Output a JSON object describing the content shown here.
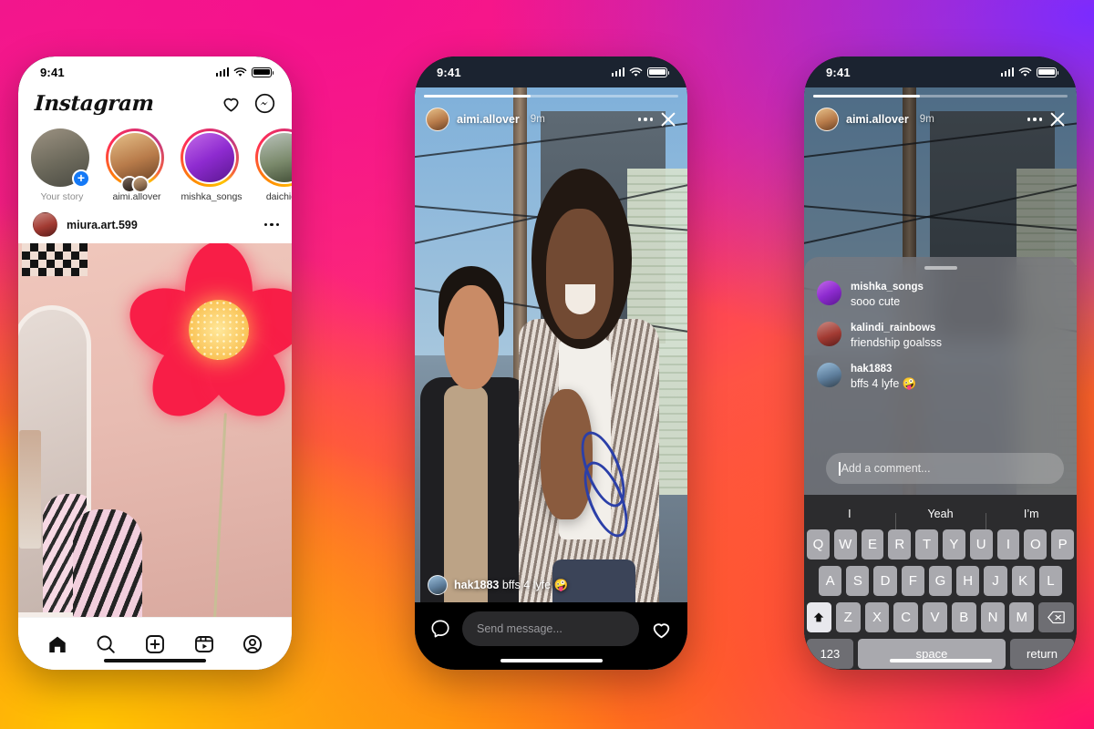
{
  "background": {
    "gradient_colors": [
      "#F01A8C",
      "#7B2BFF",
      "#FF2D72",
      "#FF8A00",
      "#FFC400"
    ]
  },
  "phone1": {
    "status": {
      "time": "9:41"
    },
    "header": {
      "logo": "Instagram",
      "like_icon": "heart-icon",
      "messenger_icon": "messenger-icon"
    },
    "stories": [
      {
        "name": "Your story",
        "has_ring": false,
        "has_plus": true,
        "avatar": "av-rock"
      },
      {
        "name": "aimi.allover",
        "has_ring": true,
        "has_plus": false,
        "avatar": "av-warm",
        "dual_badge": true
      },
      {
        "name": "mishka_songs",
        "has_ring": true,
        "has_plus": false,
        "avatar": "av-purple"
      },
      {
        "name": "daichiguy",
        "has_ring": true,
        "has_plus": false,
        "avatar": "av-grass"
      }
    ],
    "post": {
      "username": "miura.art.599",
      "menu_icon": "more-options-icon",
      "media_alt": "neon flower wall lamp in bedroom"
    },
    "tabbar": [
      {
        "icon": "home-icon",
        "label": "Home",
        "active": true
      },
      {
        "icon": "search-icon",
        "label": "Search",
        "active": false
      },
      {
        "icon": "create-icon",
        "label": "Create",
        "active": false
      },
      {
        "icon": "reels-icon",
        "label": "Reels",
        "active": false
      },
      {
        "icon": "profile-icon",
        "label": "Profile",
        "active": false
      }
    ]
  },
  "phone2": {
    "status": {
      "time": "9:41"
    },
    "story": {
      "username": "aimi.allover",
      "time_ago": "9m",
      "progress_percent": 42,
      "more_icon": "more-options-icon",
      "close_icon": "close-icon",
      "media_alt": "two friends laughing outdoors"
    },
    "caption": {
      "username": "hak1883",
      "text": "bffs 4 lyfe",
      "emoji": "🤪"
    },
    "composer": {
      "camera_icon": "message-bubble-icon",
      "placeholder": "Send message...",
      "like_icon": "heart-icon"
    }
  },
  "phone3": {
    "status": {
      "time": "9:41"
    },
    "story": {
      "username": "aimi.allover",
      "time_ago": "9m",
      "progress_percent": 42,
      "more_icon": "more-options-icon",
      "close_icon": "close-icon"
    },
    "comments": [
      {
        "username": "mishka_songs",
        "text": "sooo cute",
        "avatar": "av-purple"
      },
      {
        "username": "kalindi_rainbows",
        "text": "friendship goalsss",
        "avatar": "av-red"
      },
      {
        "username": "hak1883",
        "text": "bffs 4 lyfe 🤪",
        "avatar": "av-sky"
      }
    ],
    "add_comment": {
      "placeholder": "Add a comment...",
      "avatar": "av-dark"
    },
    "keyboard": {
      "suggestions": [
        "I",
        "Yeah",
        "I’m"
      ],
      "row1": [
        "Q",
        "W",
        "E",
        "R",
        "T",
        "Y",
        "U",
        "I",
        "O",
        "P"
      ],
      "row2": [
        "A",
        "S",
        "D",
        "F",
        "G",
        "H",
        "J",
        "K",
        "L"
      ],
      "row3": [
        "Z",
        "X",
        "C",
        "V",
        "B",
        "N",
        "M"
      ],
      "shift_icon": "shift-icon",
      "backspace_icon": "backspace-icon",
      "numbers_key": "123",
      "space_key": "space",
      "return_key": "return",
      "emoji_icon": "emoji-icon",
      "mic_icon": "microphone-icon"
    }
  }
}
